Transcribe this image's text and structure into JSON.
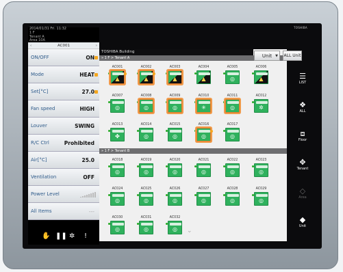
{
  "left": {
    "datetime": "2014/01/31  Fri. 11:32",
    "tree": [
      "1 F",
      "Tenant A",
      "Area 10A"
    ],
    "selected_unit": "AC001",
    "props": [
      {
        "label": "ON/OFF",
        "value": "ON",
        "dot": true
      },
      {
        "label": "Mode",
        "value": "HEAT",
        "dot": true
      },
      {
        "label": "Set[°C]",
        "value": "27.0",
        "dot": true
      },
      {
        "label": "Fan speed",
        "value": "HIGH",
        "dot": false
      },
      {
        "label": "Louver",
        "value": "SWING",
        "dot": false
      },
      {
        "label": "R/C Ctrl",
        "value": "Prohibited",
        "dot": false
      },
      {
        "label": "Air[°C]",
        "value": "25.0",
        "dot": false
      },
      {
        "label": "Ventilation",
        "value": "OFF",
        "dot": false
      },
      {
        "label": "Power Level",
        "value": "",
        "dot": false
      },
      {
        "label": "All Items",
        "value": "---",
        "dot": false
      }
    ]
  },
  "main": {
    "building": "TOSHIBA Building",
    "section_a": "» 1 F > Tenant A",
    "section_b": "» 1 F > Tenant B",
    "unit_dropdown": "Unit",
    "all_unit": "ALL Unit"
  },
  "units_a": [
    {
      "name": "AC001",
      "sym": "▲",
      "sel": true,
      "dark": true,
      "badge": true
    },
    {
      "name": "AC002",
      "sym": "▲",
      "sel": true,
      "dark": true,
      "badge": true
    },
    {
      "name": "AC003",
      "sym": "▲",
      "sel": true,
      "dark": true,
      "badge": false
    },
    {
      "name": "AC004",
      "sym": "▲",
      "sel": false,
      "dark": true,
      "badge": false
    },
    {
      "name": "AC005",
      "sym": "◎",
      "sel": false,
      "dark": false,
      "badge": false
    },
    {
      "name": "AC006",
      "sym": "▲",
      "sel": false,
      "dark": true,
      "badge": false
    },
    {
      "name": "AC007",
      "sym": "◎",
      "sel": false,
      "dark": false,
      "badge": false
    },
    {
      "name": "AC008",
      "sym": "◎",
      "sel": true,
      "dark": false,
      "badge": false
    },
    {
      "name": "AC009",
      "sym": "◎",
      "sel": true,
      "dark": false,
      "badge": false
    },
    {
      "name": "AC010",
      "sym": "✳",
      "sel": true,
      "dark": false,
      "badge": false
    },
    {
      "name": "AC011",
      "sym": "◎",
      "sel": true,
      "dark": false,
      "badge": false
    },
    {
      "name": "AC012",
      "sym": "✲",
      "sel": false,
      "dark": false,
      "badge": false
    },
    {
      "name": "AC013",
      "sym": "✤",
      "sel": false,
      "dark": false,
      "badge": false
    },
    {
      "name": "AC014",
      "sym": "◎",
      "sel": false,
      "dark": false,
      "badge": false
    },
    {
      "name": "AC015",
      "sym": "◎",
      "sel": false,
      "dark": false,
      "badge": false
    },
    {
      "name": "AC016",
      "sym": "◎",
      "sel": true,
      "dark": false,
      "badge": true
    },
    {
      "name": "AC017",
      "sym": "◎",
      "sel": false,
      "dark": false,
      "badge": false
    }
  ],
  "units_b": [
    {
      "name": "AC018",
      "sym": "◎"
    },
    {
      "name": "AC019",
      "sym": "◎"
    },
    {
      "name": "AC020",
      "sym": "◎"
    },
    {
      "name": "AC021",
      "sym": "◎"
    },
    {
      "name": "AC022",
      "sym": "◎"
    },
    {
      "name": "AC023",
      "sym": "◎"
    },
    {
      "name": "AC024",
      "sym": "◎"
    },
    {
      "name": "AC025",
      "sym": "◎"
    },
    {
      "name": "AC026",
      "sym": "◎"
    },
    {
      "name": "AC027",
      "sym": "◎"
    },
    {
      "name": "AC028",
      "sym": "◎"
    },
    {
      "name": "AC029",
      "sym": "◎"
    },
    {
      "name": "AC030",
      "sym": "◎"
    },
    {
      "name": "AC031",
      "sym": "◎"
    },
    {
      "name": "AC032",
      "sym": "◎"
    }
  ],
  "nav": {
    "brand": "TOSHIBA",
    "items": [
      {
        "label": "LIST",
        "icon": "list-icon",
        "glyph": "☰"
      },
      {
        "label": "ALL",
        "icon": "all-icon",
        "glyph": "❖"
      },
      {
        "label": "Floor",
        "icon": "floor-icon",
        "glyph": "⧈"
      },
      {
        "label": "Tenant",
        "icon": "tenant-icon",
        "glyph": "✥"
      },
      {
        "label": "Area",
        "icon": "area-icon",
        "glyph": "◇",
        "disabled": true
      },
      {
        "label": "Unit",
        "icon": "unit-icon",
        "glyph": "◆"
      }
    ]
  },
  "colors": {
    "unit_green": "#2fb15d",
    "selection_orange": "#f09a4a",
    "badge_orange": "#f5a71f"
  }
}
